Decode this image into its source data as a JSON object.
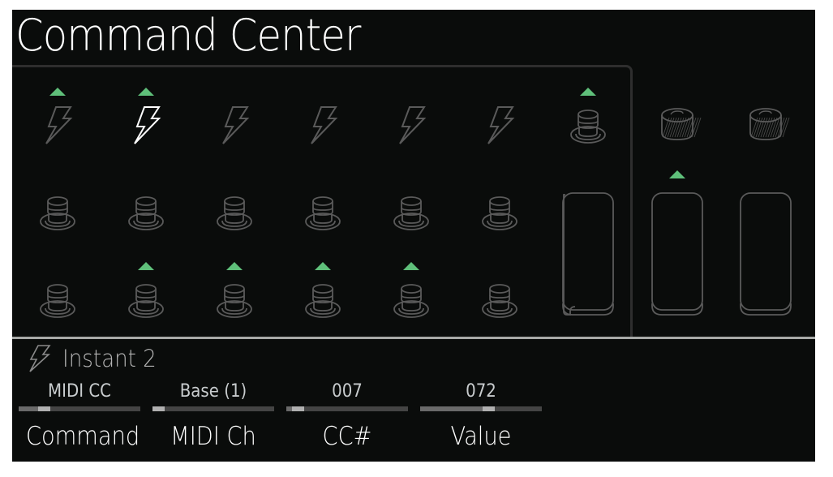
{
  "title": "Command Center",
  "colors": {
    "accent_green": "#5fbf7a",
    "icon_dim": "#5a5a5a",
    "icon_selected": "#ffffff",
    "background": "#0a0c0b"
  },
  "grid": {
    "rows": [
      {
        "items": [
          {
            "type": "instant-lightning-icon",
            "assigned": true,
            "selected": false
          },
          {
            "type": "instant-lightning-icon",
            "assigned": true,
            "selected": true
          },
          {
            "type": "instant-lightning-icon",
            "assigned": false,
            "selected": false
          },
          {
            "type": "instant-lightning-icon",
            "assigned": false,
            "selected": false
          },
          {
            "type": "instant-lightning-icon",
            "assigned": false,
            "selected": false
          },
          {
            "type": "instant-lightning-icon",
            "assigned": false,
            "selected": false
          },
          {
            "type": "footswitch-icon",
            "assigned": true,
            "selected": false
          }
        ]
      },
      {
        "items": [
          {
            "type": "footswitch-icon",
            "assigned": false
          },
          {
            "type": "footswitch-icon",
            "assigned": false
          },
          {
            "type": "footswitch-icon",
            "assigned": false
          },
          {
            "type": "footswitch-icon",
            "assigned": false
          },
          {
            "type": "footswitch-icon",
            "assigned": false
          },
          {
            "type": "footswitch-icon",
            "assigned": false
          }
        ]
      },
      {
        "items": [
          {
            "type": "footswitch-icon",
            "assigned": false
          },
          {
            "type": "footswitch-icon",
            "assigned": true
          },
          {
            "type": "footswitch-icon",
            "assigned": true
          },
          {
            "type": "footswitch-icon",
            "assigned": true
          },
          {
            "type": "footswitch-icon",
            "assigned": true
          },
          {
            "type": "footswitch-icon",
            "assigned": false
          }
        ]
      }
    ],
    "pedals": [
      {
        "type": "expression-pedal-toe-switch-icon",
        "assigned": false
      },
      {
        "type": "expression-pedal-icon",
        "assigned": true
      },
      {
        "type": "expression-pedal-icon",
        "assigned": false
      }
    ],
    "knobs": [
      {
        "type": "knob-icon",
        "assigned": false
      },
      {
        "type": "knob-icon",
        "assigned": false
      }
    ]
  },
  "selected": {
    "icon": "instant-lightning-icon",
    "label": "Instant 2"
  },
  "params": [
    {
      "label": "Command",
      "value": "MIDI CC",
      "position": 0.18
    },
    {
      "label": "MIDI Ch",
      "value": "Base (1)",
      "position": 0.0
    },
    {
      "label": "CC#",
      "value": "007",
      "position": 0.055
    },
    {
      "label": "Value",
      "value": "072",
      "position": 0.567
    }
  ]
}
